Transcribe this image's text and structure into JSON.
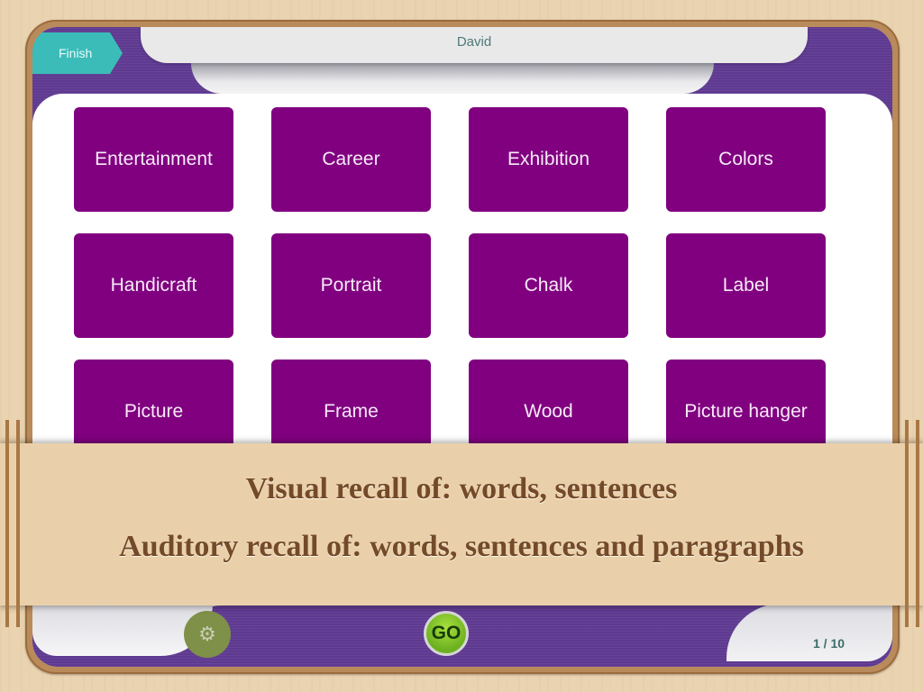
{
  "header": {
    "user_name": "David",
    "finish_label": "Finish"
  },
  "tiles": [
    {
      "label": "Entertainment"
    },
    {
      "label": "Career"
    },
    {
      "label": "Exhibition"
    },
    {
      "label": "Colors"
    },
    {
      "label": "Handicraft"
    },
    {
      "label": "Portrait"
    },
    {
      "label": "Chalk"
    },
    {
      "label": "Label"
    },
    {
      "label": "Picture"
    },
    {
      "label": "Frame"
    },
    {
      "label": "Wood"
    },
    {
      "label": "Picture hanger"
    }
  ],
  "banner": {
    "line1": "Visual recall of: words, sentences",
    "line2": "Auditory recall of: words, sentences and paragraphs"
  },
  "footer": {
    "settings_icon": "gears-icon",
    "go_label": "GO",
    "page_counter": "1 / 10"
  },
  "colors": {
    "tile": "#800080",
    "accent_teal": "#3bbcb8",
    "frame_purple": "#5f3a91",
    "go_green": "#7cc22a"
  }
}
